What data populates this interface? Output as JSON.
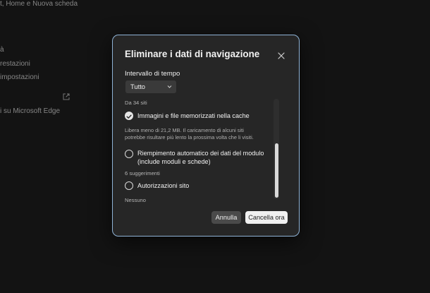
{
  "background": {
    "line1": "t, Home e Nuova scheda",
    "line2": "à",
    "line3": "restazioni",
    "line4": "impostazioni",
    "line5": "i su Microsoft Edge"
  },
  "dialog": {
    "title": "Eliminare i dati di navigazione",
    "time_range_label": "Intervallo di tempo",
    "time_range_value": "Tutto",
    "scroll_top_text": "Da 34 siti",
    "options": [
      {
        "label": "Immagini e file memorizzati nella cache",
        "checked": true,
        "description_lines": [
          "Libera meno di 21,2 MB. Il caricamento di alcuni siti",
          "potrebbe risultare più lento la prossima volta che li visiti."
        ]
      },
      {
        "label_lines": [
          "Riempimento automatico dei dati del modulo",
          "(include moduli e schede)"
        ],
        "checked": false,
        "description": "6 suggerimenti"
      },
      {
        "label": "Autorizzazioni sito",
        "checked": false,
        "description": "Nessuno"
      }
    ],
    "cancel_label": "Annulla",
    "confirm_label": "Cancella ora"
  },
  "colors": {
    "dialog_border": "#8fb3d6",
    "primary_button": "#f0f0f0",
    "secondary_button": "#4a4a4a"
  }
}
